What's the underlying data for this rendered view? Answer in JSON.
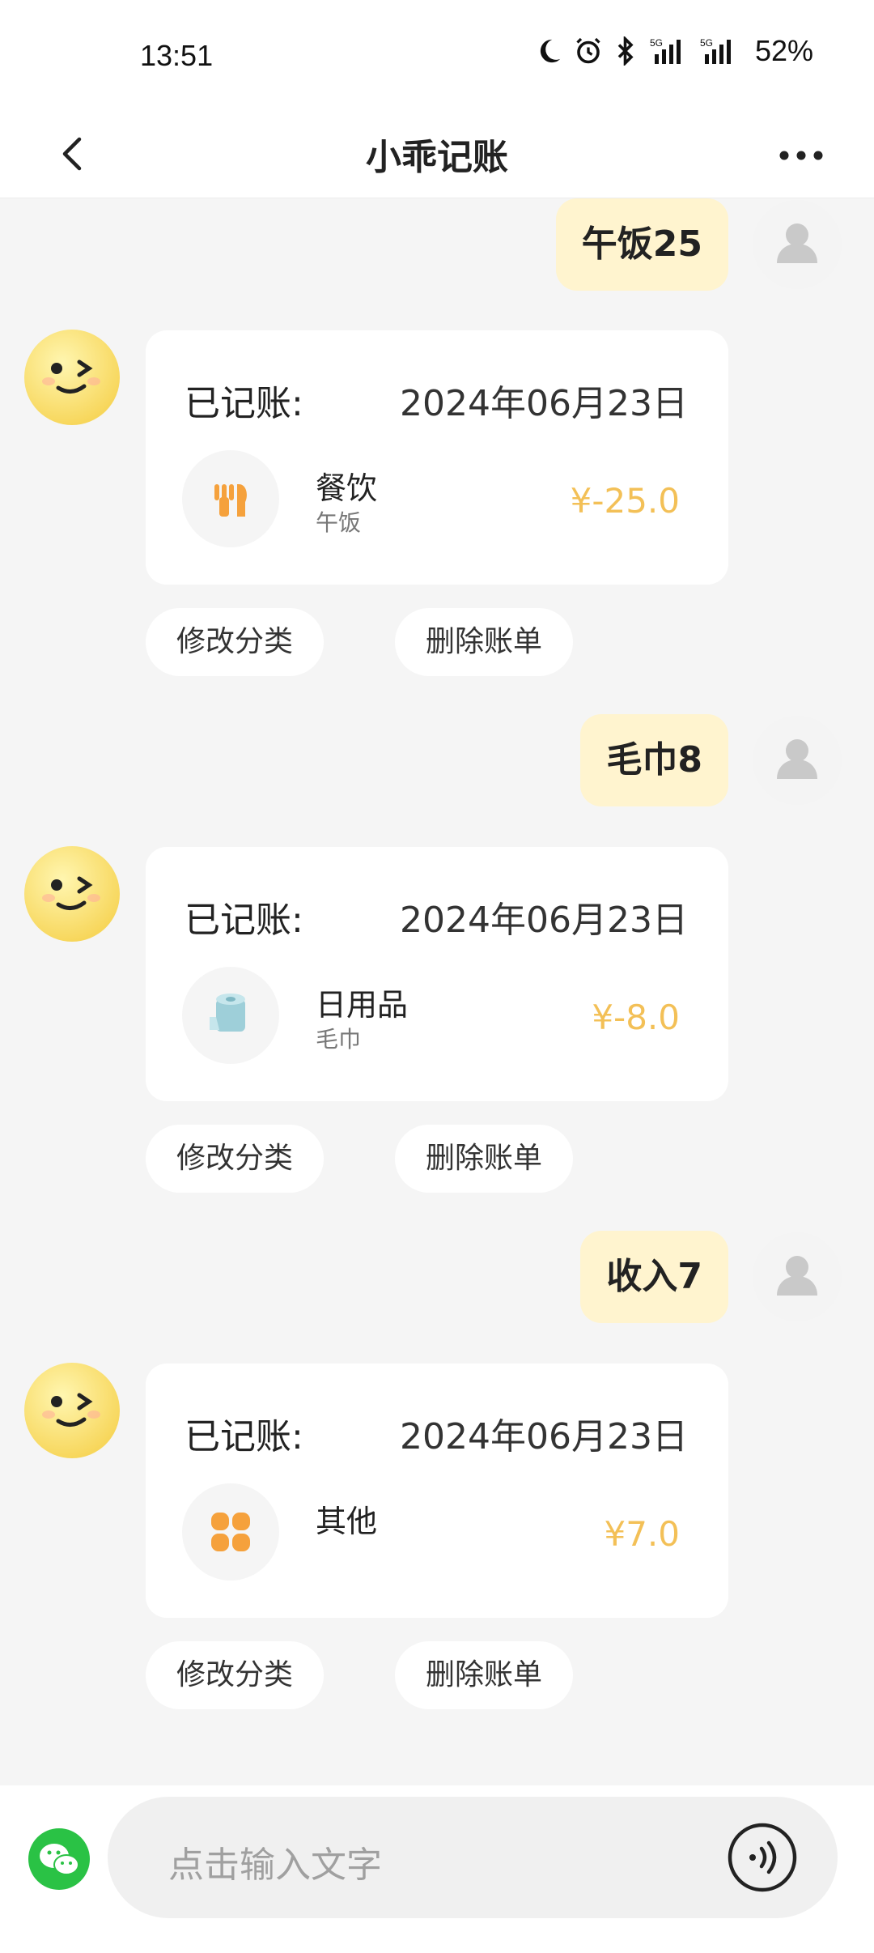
{
  "status_bar": {
    "time": "13:51",
    "battery": "52%",
    "icons": [
      "moon-icon",
      "alarm-icon",
      "bluetooth-icon",
      "5g-signal-icon",
      "5g-signal-icon"
    ]
  },
  "header": {
    "title": "小乖记账"
  },
  "messages": [
    {
      "user_text": "午饭25",
      "card": {
        "label": "已记账:",
        "date": "2024年06月23日",
        "category": "餐饮",
        "note": "午饭",
        "amount": "¥-25.0",
        "icon": "fork-knife-icon"
      },
      "actions": [
        "修改分类",
        "删除账单"
      ]
    },
    {
      "user_text": "毛巾8",
      "card": {
        "label": "已记账:",
        "date": "2024年06月23日",
        "category": "日用品",
        "note": "毛巾",
        "amount": "¥-8.0",
        "icon": "tissue-roll-icon"
      },
      "actions": [
        "修改分类",
        "删除账单"
      ]
    },
    {
      "user_text": "收入7",
      "card": {
        "label": "已记账:",
        "date": "2024年06月23日",
        "category": "其他",
        "note": "",
        "amount": "¥7.0",
        "icon": "grid-icon"
      },
      "actions": [
        "修改分类",
        "删除账单"
      ]
    }
  ],
  "input": {
    "placeholder": "点击输入文字"
  },
  "colors": {
    "accent": "#f3c057",
    "user_bubble": "#fff4cf",
    "wechat": "#2ac245"
  }
}
